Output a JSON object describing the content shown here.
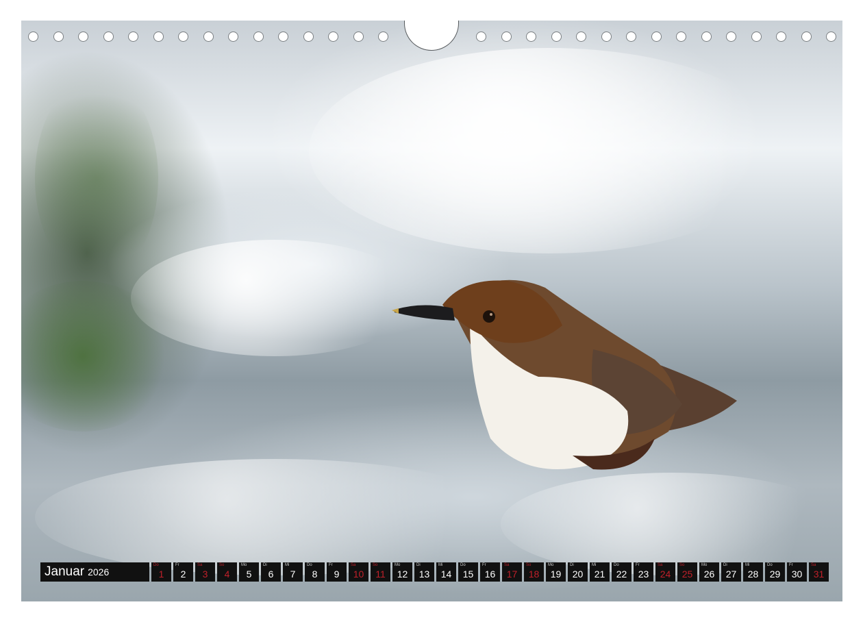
{
  "calendar": {
    "month": "Januar",
    "year": "2026",
    "days": [
      {
        "wd": "Do",
        "num": "1",
        "red": true
      },
      {
        "wd": "Fr",
        "num": "2",
        "red": false
      },
      {
        "wd": "Sa",
        "num": "3",
        "red": true
      },
      {
        "wd": "So",
        "num": "4",
        "red": true
      },
      {
        "wd": "Mo",
        "num": "5",
        "red": false
      },
      {
        "wd": "Di",
        "num": "6",
        "red": false
      },
      {
        "wd": "Mi",
        "num": "7",
        "red": false
      },
      {
        "wd": "Do",
        "num": "8",
        "red": false
      },
      {
        "wd": "Fr",
        "num": "9",
        "red": false
      },
      {
        "wd": "Sa",
        "num": "10",
        "red": true
      },
      {
        "wd": "So",
        "num": "11",
        "red": true
      },
      {
        "wd": "Mo",
        "num": "12",
        "red": false
      },
      {
        "wd": "Di",
        "num": "13",
        "red": false
      },
      {
        "wd": "Mi",
        "num": "14",
        "red": false
      },
      {
        "wd": "Do",
        "num": "15",
        "red": false
      },
      {
        "wd": "Fr",
        "num": "16",
        "red": false
      },
      {
        "wd": "Sa",
        "num": "17",
        "red": true
      },
      {
        "wd": "So",
        "num": "18",
        "red": true
      },
      {
        "wd": "Mo",
        "num": "19",
        "red": false
      },
      {
        "wd": "Di",
        "num": "20",
        "red": false
      },
      {
        "wd": "Mi",
        "num": "21",
        "red": false
      },
      {
        "wd": "Do",
        "num": "22",
        "red": false
      },
      {
        "wd": "Fr",
        "num": "23",
        "red": false
      },
      {
        "wd": "Sa",
        "num": "24",
        "red": true
      },
      {
        "wd": "So",
        "num": "25",
        "red": true
      },
      {
        "wd": "Mo",
        "num": "26",
        "red": false
      },
      {
        "wd": "Di",
        "num": "27",
        "red": false
      },
      {
        "wd": "Mi",
        "num": "28",
        "red": false
      },
      {
        "wd": "Do",
        "num": "29",
        "red": false
      },
      {
        "wd": "Fr",
        "num": "30",
        "red": false
      },
      {
        "wd": "Sa",
        "num": "31",
        "red": true
      }
    ],
    "colors": {
      "cell_bg": "#111111",
      "text": "#ffffff",
      "holiday": "#c0202a"
    }
  },
  "photo": {
    "subject": "dipper-bird-in-river",
    "colors": {
      "bird_head": "#6e3f1c",
      "bird_breast": "#f4f1ea",
      "water": "#b9c3ca",
      "moss": "#466e32"
    }
  }
}
